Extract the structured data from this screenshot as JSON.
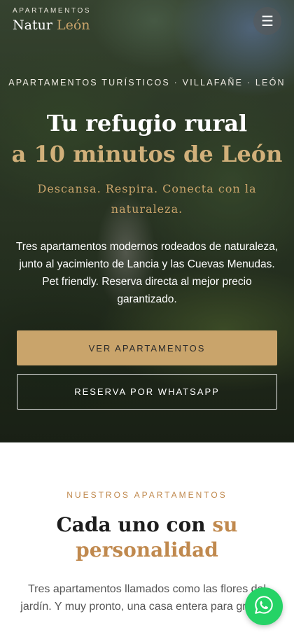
{
  "header": {
    "brand_top": "APARTAMENTOS",
    "brand_word1": "Natur",
    "brand_word2": "León",
    "menu_icon": "hamburger-icon"
  },
  "hero": {
    "eyebrow": "APARTAMENTOS TURÍSTICOS · VILLAFAÑE · LEÓN",
    "title_line1": "Tu refugio rural",
    "title_line2": "a 10 minutos de León",
    "subtitle": "Descansa. Respira. Conecta con la naturaleza.",
    "description": "Tres apartamentos modernos rodeados de naturaleza, junto al yacimiento de Lancia y las Cuevas Menudas. Pet friendly. Reserva directa al mejor precio garantizado.",
    "primary_button": "VER APARTAMENTOS",
    "secondary_button": "RESERVA POR WHATSAPP"
  },
  "apartments": {
    "eyebrow": "NUESTROS APARTAMENTOS",
    "title_part1": "Cada uno con ",
    "title_part2": "su personalidad",
    "description": "Tres apartamentos llamados como las flores del jardín. Y muy pronto, una casa entera para grupos."
  },
  "fab": {
    "icon": "whatsapp-icon"
  },
  "colors": {
    "accent_gold": "#c9a46b",
    "section_gold": "#c0894e",
    "whatsapp_green": "#25d366"
  }
}
